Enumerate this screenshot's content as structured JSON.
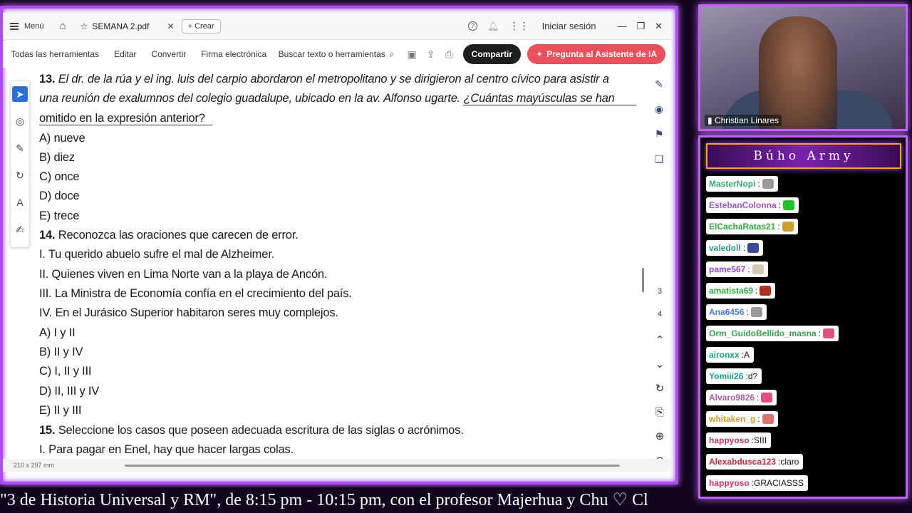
{
  "window": {
    "menu_label": "Menú",
    "tab_title": "SEMANA 2.pdf",
    "create_label": "Crear",
    "sign_in": "Iniciar sesión"
  },
  "toolbar": {
    "items": [
      "Todas las herramientas",
      "Editar",
      "Convertir",
      "Firma electrónica"
    ],
    "search_label": "Buscar texto o herramientas",
    "share_label": "Compartir",
    "ai_label": "Pregunta al Asistente de IA"
  },
  "document": {
    "q13_number": "13.",
    "q13_line1": "El dr. de la rúa y el ing. luis del carpio abordaron el metropolitano y se dirigieron al centro cívico para asistir a",
    "q13_line2a": "una reunión de exalumnos del colegio guadalupe, ubicado en la av. Alfonso ugarte.",
    "q13_line2b": "¿Cuántas mayúsculas se han",
    "q13_line3": "omitido en la expresión anterior?",
    "q13_options": [
      "A) nueve",
      "B) diez",
      "C) once",
      "D) doce",
      "E) trece"
    ],
    "q14_number": "14.",
    "q14_text": "Reconozca las oraciones que carecen de error.",
    "q14_statements": [
      "I. Tu querido abuelo sufre el mal de Alzheimer.",
      "II. Quienes viven en Lima Norte van a la playa de Ancón.",
      "III. La Ministra de Economía confía en el crecimiento del país.",
      "IV. En el Jurásico Superior habitaron seres muy complejos."
    ],
    "q14_options": [
      "A) I y II",
      "B) II y IV",
      "C) I, II y III",
      "D) II, III y IV",
      "E) II y III"
    ],
    "q15_number": "15.",
    "q15_text": "Seleccione los casos que poseen adecuada escritura de las siglas o acrónimos.",
    "q15_statement1": "I. Para pagar en Enel, hay que hacer largas colas."
  },
  "page_nav": {
    "pages": [
      "3",
      "4"
    ]
  },
  "status": {
    "page_size": "210 x 297 mm"
  },
  "ticker": {
    "text": "\"3 de Historia Universal y RM\", de 8:15 pm - 10:15 pm, con el profesor Majerhua y Chu ♡    Cl"
  },
  "camera": {
    "name": "Christian Linares"
  },
  "chat": {
    "title": "Búho Army",
    "messages": [
      {
        "user": "MasterNopi",
        "text": "",
        "color": "#39a86a",
        "emote": "#9a9a9a"
      },
      {
        "user": "EstebanColonna",
        "text": "",
        "color": "#9b59c8",
        "emote": "#22c02a"
      },
      {
        "user": "ElCachaRatas21",
        "text": "",
        "color": "#2faa3b",
        "emote": "#c9a030"
      },
      {
        "user": "valedoll",
        "text": "",
        "color": "#1f9e8e",
        "emote": "#3a4a9a"
      },
      {
        "user": "pame567",
        "text": "",
        "color": "#8a47c9",
        "emote": "#d8c8b8"
      },
      {
        "user": "amatista69",
        "text": "",
        "color": "#2da83c",
        "emote": "#b03020"
      },
      {
        "user": "Ana6456",
        "text": "",
        "color": "#4a7acb",
        "emote": "#9a9a9a"
      },
      {
        "user": "Orm_GuidoBellido_masna",
        "text": "",
        "color": "#3aa050",
        "emote": "#e05080"
      },
      {
        "user": "aironxx",
        "text": "A",
        "color": "#1f9e8e",
        "emote": ""
      },
      {
        "user": "Yomiii26",
        "text": "d?",
        "color": "#1f9e8e",
        "emote": ""
      },
      {
        "user": "Alvaro9826",
        "text": "",
        "color": "#b05aa0",
        "emote": "#e05080"
      },
      {
        "user": "whitaken_g",
        "text": "",
        "color": "#c99a30",
        "emote": "#e07070"
      },
      {
        "user": "happyoso",
        "text": "SIII",
        "color": "#c0306a",
        "emote": ""
      },
      {
        "user": "Alexabdusca123",
        "text": "claro",
        "color": "#c0283a",
        "emote": ""
      },
      {
        "user": "happyoso",
        "text": "GRACIASSS",
        "color": "#c0306a",
        "emote": ""
      }
    ]
  }
}
